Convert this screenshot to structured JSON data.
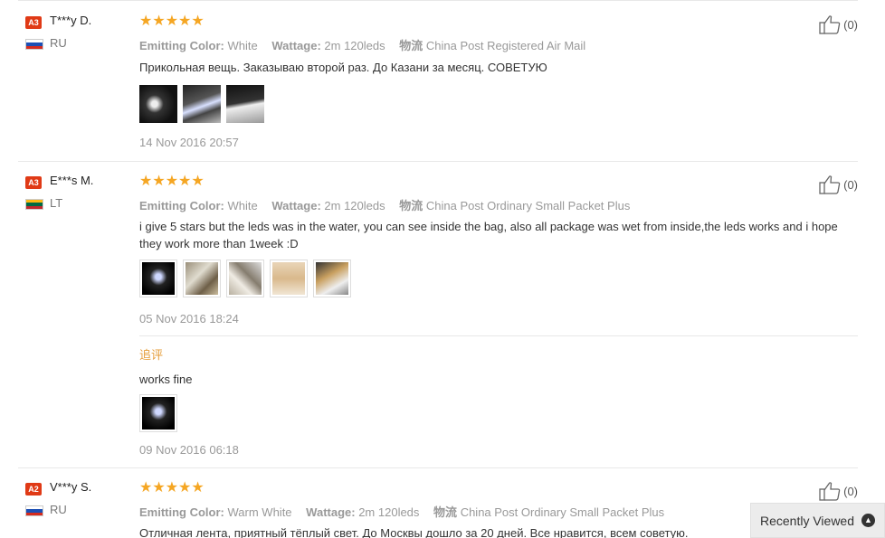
{
  "reviews": [
    {
      "level": "A3",
      "name": "T***y D.",
      "country": "RU",
      "flag_colors": [
        "#ffffff",
        "#1c4fb5",
        "#d52b1e"
      ],
      "stars": "★★★★★",
      "color_label": "Emitting Color:",
      "color_value": "White",
      "wattage_label": "Wattage:",
      "wattage_value": "2m 120leds",
      "shipping_label": "物流",
      "shipping_value": "China Post Registered Air Mail",
      "text": "Прикольная вещь. Заказываю второй раз. До Казани за месяц. СОВЕТУЮ",
      "date": "14 Nov 2016 20:57",
      "helpful": "(0)"
    },
    {
      "level": "A3",
      "name": "E***s M.",
      "country": "LT",
      "flag_colors": [
        "#fdb913",
        "#006a44",
        "#c1272d"
      ],
      "stars": "★★★★★",
      "color_label": "Emitting Color:",
      "color_value": "White",
      "wattage_label": "Wattage:",
      "wattage_value": "2m 120leds",
      "shipping_label": "物流",
      "shipping_value": "China Post Ordinary Small Packet Plus",
      "text": "i give 5 stars but the leds was in the water, you can see inside the bag, also all package was wet from inside,the leds works and i hope they work more than 1week :D",
      "date": "05 Nov 2016 18:24",
      "followup_label": "追评",
      "followup_text": "works fine",
      "followup_date": "09 Nov 2016 06:18",
      "helpful": "(0)"
    },
    {
      "level": "A2",
      "name": "V***y S.",
      "country": "RU",
      "flag_colors": [
        "#ffffff",
        "#1c4fb5",
        "#d52b1e"
      ],
      "stars": "★★★★★",
      "color_label": "Emitting Color:",
      "color_value": "Warm White",
      "wattage_label": "Wattage:",
      "wattage_value": "2m 120leds",
      "shipping_label": "物流",
      "shipping_value": "China Post Ordinary Small Packet Plus",
      "text": "Отличная лента, приятный тёплый свет. До Москвы дошло за 20 дней. Все нравится, всем советую.",
      "helpful": "(0)"
    }
  ],
  "recently_viewed": "Recently Viewed",
  "colors": {
    "badge": "#e03a16",
    "stars": "#f5a623",
    "followup": "#e59d3a"
  }
}
